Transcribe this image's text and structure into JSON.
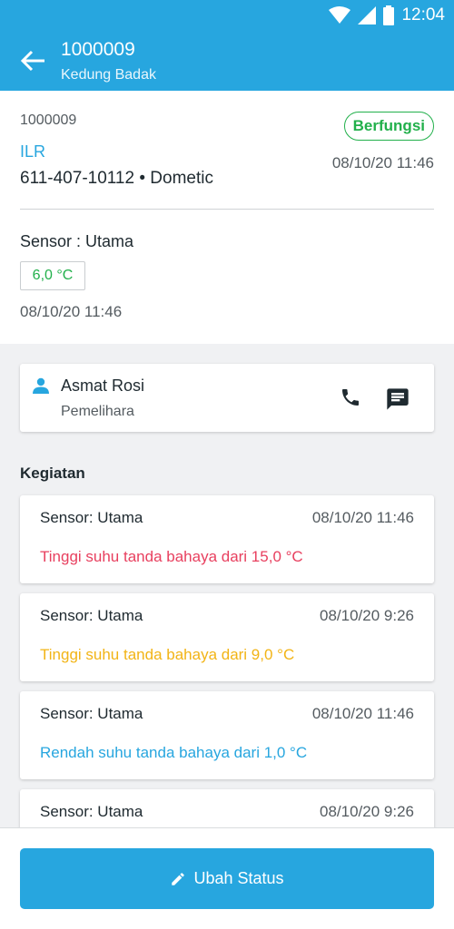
{
  "status_bar": {
    "time": "12:04",
    "icons": [
      "wifi-icon",
      "cell-signal-icon",
      "battery-icon"
    ]
  },
  "app_bar": {
    "title": "1000009",
    "subtitle": "Kedung Badak",
    "back_icon": "arrow-left-icon"
  },
  "device": {
    "id": "1000009",
    "type": "ILR",
    "serial_brand": "611-407-10112 • Dometic",
    "status": "Berfungsi",
    "status_date": "08/10/20 11:46",
    "sensor_label": "Sensor : Utama",
    "temperature": "6,0 °C",
    "reading_date": "08/10/20 11:46"
  },
  "contact": {
    "name": "Asmat Rosi",
    "role": "Pemelihara",
    "icons": [
      "person-icon",
      "phone-icon",
      "message-icon"
    ]
  },
  "activities_title": "Kegiatan",
  "activities": [
    {
      "sensor": "Sensor: Utama",
      "date": "08/10/20 11:46",
      "message": "Tinggi suhu tanda bahaya dari 15,0 °C",
      "color": "#e8405f"
    },
    {
      "sensor": "Sensor: Utama",
      "date": "08/10/20 9:26",
      "message": "Tinggi suhu tanda bahaya dari 9,0 °C",
      "color": "#f2b416"
    },
    {
      "sensor": "Sensor: Utama",
      "date": "08/10/20 11:46",
      "message": "Rendah suhu tanda bahaya dari 1,0 °C",
      "color": "#27a6df"
    },
    {
      "sensor": "Sensor: Utama",
      "date": "08/10/20 9:26",
      "message": "",
      "color": "#27a6df"
    }
  ],
  "action_button": {
    "label": "Ubah Status",
    "icon": "pencil-icon"
  },
  "colors": {
    "primary": "#27a6df",
    "success": "#22b04b",
    "danger": "#e8405f",
    "warning": "#f2b416"
  }
}
